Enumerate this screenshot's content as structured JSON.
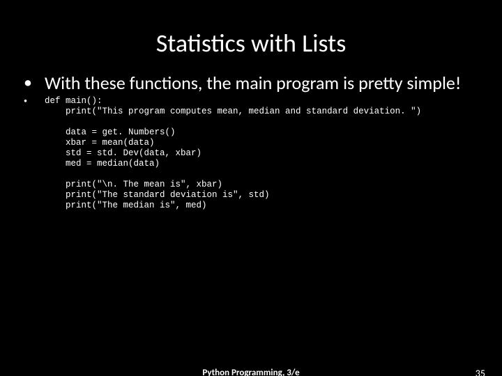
{
  "title": "Statistics with Lists",
  "bullet1": "With these functions, the main program is pretty simple!",
  "code": "def main():\n    print(\"This program computes mean, median and standard deviation. \")\n\n    data = get. Numbers()\n    xbar = mean(data)\n    std = std. Dev(data, xbar)\n    med = median(data)\n\n    print(\"\\n. The mean is\", xbar)\n    print(\"The standard deviation is\", std)\n    print(\"The median is\", med)",
  "footer_center": "Python Programming, 3/e",
  "footer_right": "35"
}
